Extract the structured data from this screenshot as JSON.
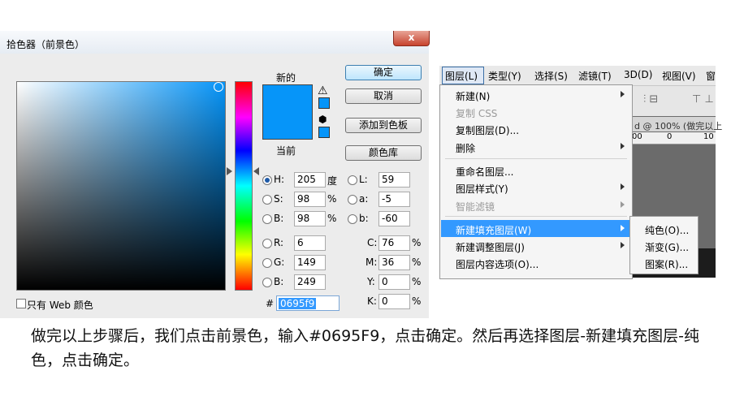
{
  "dialog": {
    "title": "拾色器（前景色）",
    "close_label": "x",
    "new_label": "新的",
    "current_label": "当前",
    "buttons": {
      "ok": "确定",
      "cancel": "取消",
      "add_to_swatches": "添加到色板",
      "color_libraries": "颜色库"
    },
    "fields": {
      "H": {
        "label": "H:",
        "value": "205",
        "unit": "度"
      },
      "S": {
        "label": "S:",
        "value": "98",
        "unit": "%"
      },
      "B": {
        "label": "B:",
        "value": "98",
        "unit": "%"
      },
      "L": {
        "label": "L:",
        "value": "59"
      },
      "a": {
        "label": "a:",
        "value": "-5"
      },
      "b": {
        "label": "b:",
        "value": "-60"
      },
      "R": {
        "label": "R:",
        "value": "6"
      },
      "G": {
        "label": "G:",
        "value": "149"
      },
      "Bl": {
        "label": "B:",
        "value": "249"
      },
      "C": {
        "label": "C:",
        "value": "76",
        "unit": "%"
      },
      "M": {
        "label": "M:",
        "value": "36",
        "unit": "%"
      },
      "Y": {
        "label": "Y:",
        "value": "0",
        "unit": "%"
      },
      "K": {
        "label": "K:",
        "value": "0",
        "unit": "%"
      }
    },
    "hex_label": "#",
    "hex_value": "0695f9",
    "web_only_label": "只有 Web 颜色",
    "color": "#0695f9"
  },
  "menubar": {
    "items": [
      "图层(L)",
      "类型(Y)",
      "选择(S)",
      "滤镜(T)",
      "3D(D)",
      "视图(V)",
      "窗"
    ]
  },
  "dropdown": {
    "items": [
      "新建(N)",
      "复制 CSS",
      "复制图层(D)...",
      "删除",
      "重命名图层...",
      "图层样式(Y)",
      "智能滤镜",
      "新建填充图层(W)",
      "新建调整图层(J)",
      "图层内容选项(O)..."
    ]
  },
  "submenu": {
    "items": [
      "纯色(O)...",
      "渐变(G)...",
      "图案(R)..."
    ]
  },
  "ps": {
    "doc_tab": "d @ 100% (做完以上",
    "ruler": [
      "00",
      "0",
      "10"
    ]
  },
  "caption": "做完以上步骤后，我们点击前景色，输入#0695F9，点击确定。然后再选择图层-新建填充图层-纯色，点击确定。"
}
